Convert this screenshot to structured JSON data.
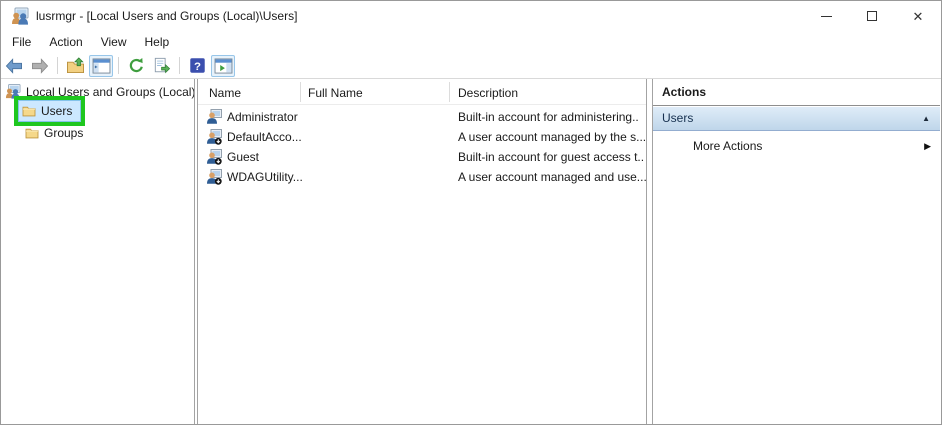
{
  "window": {
    "title": "lusrmgr - [Local Users and Groups (Local)\\Users]",
    "close_glyph": "✕"
  },
  "menu": {
    "items": [
      {
        "label": "File"
      },
      {
        "label": "Action"
      },
      {
        "label": "View"
      },
      {
        "label": "Help"
      }
    ]
  },
  "toolbar": {
    "buttons": [
      {
        "name": "back",
        "toggled": false
      },
      {
        "name": "forward",
        "toggled": false
      },
      {
        "name": "up-one-level",
        "toggled": false
      },
      {
        "name": "show-console-tree",
        "toggled": true
      },
      {
        "name": "refresh",
        "toggled": false
      },
      {
        "name": "export-list",
        "toggled": false
      },
      {
        "name": "help",
        "toggled": false
      },
      {
        "name": "show-action-pane",
        "toggled": true
      }
    ]
  },
  "tree": {
    "root_label": "Local Users and Groups (Local)",
    "items": [
      {
        "label": "Users",
        "selected": true,
        "annotated": true
      },
      {
        "label": "Groups",
        "selected": false,
        "annotated": false
      }
    ]
  },
  "list": {
    "columns": [
      {
        "label": "Name"
      },
      {
        "label": "Full Name"
      },
      {
        "label": "Description"
      }
    ],
    "rows": [
      {
        "name": "Administrator",
        "full_name": "",
        "description": "Built-in account for administering..",
        "disabled": false
      },
      {
        "name": "DefaultAcco...",
        "full_name": "",
        "description": "A user account managed by the s...",
        "disabled": true
      },
      {
        "name": "Guest",
        "full_name": "",
        "description": "Built-in account for guest access t..",
        "disabled": true
      },
      {
        "name": "WDAGUtility...",
        "full_name": "",
        "description": "A user account managed and use...",
        "disabled": true
      }
    ]
  },
  "actions": {
    "title": "Actions",
    "group_label": "Users",
    "collapse_glyph": "▲",
    "more_actions_label": "More Actions",
    "expand_glyph": "▶"
  },
  "colors": {
    "annotation_green": "#1fc71f",
    "tree_selection_bg": "#cce8ff",
    "tree_selection_border": "#84c3ea",
    "actions_bar_gradient_top": "#dfecf8",
    "actions_bar_gradient_bottom": "#bfd6ea",
    "toolbar_toggle_bg": "#e7f2fb",
    "toolbar_toggle_border": "#98c6e9"
  }
}
